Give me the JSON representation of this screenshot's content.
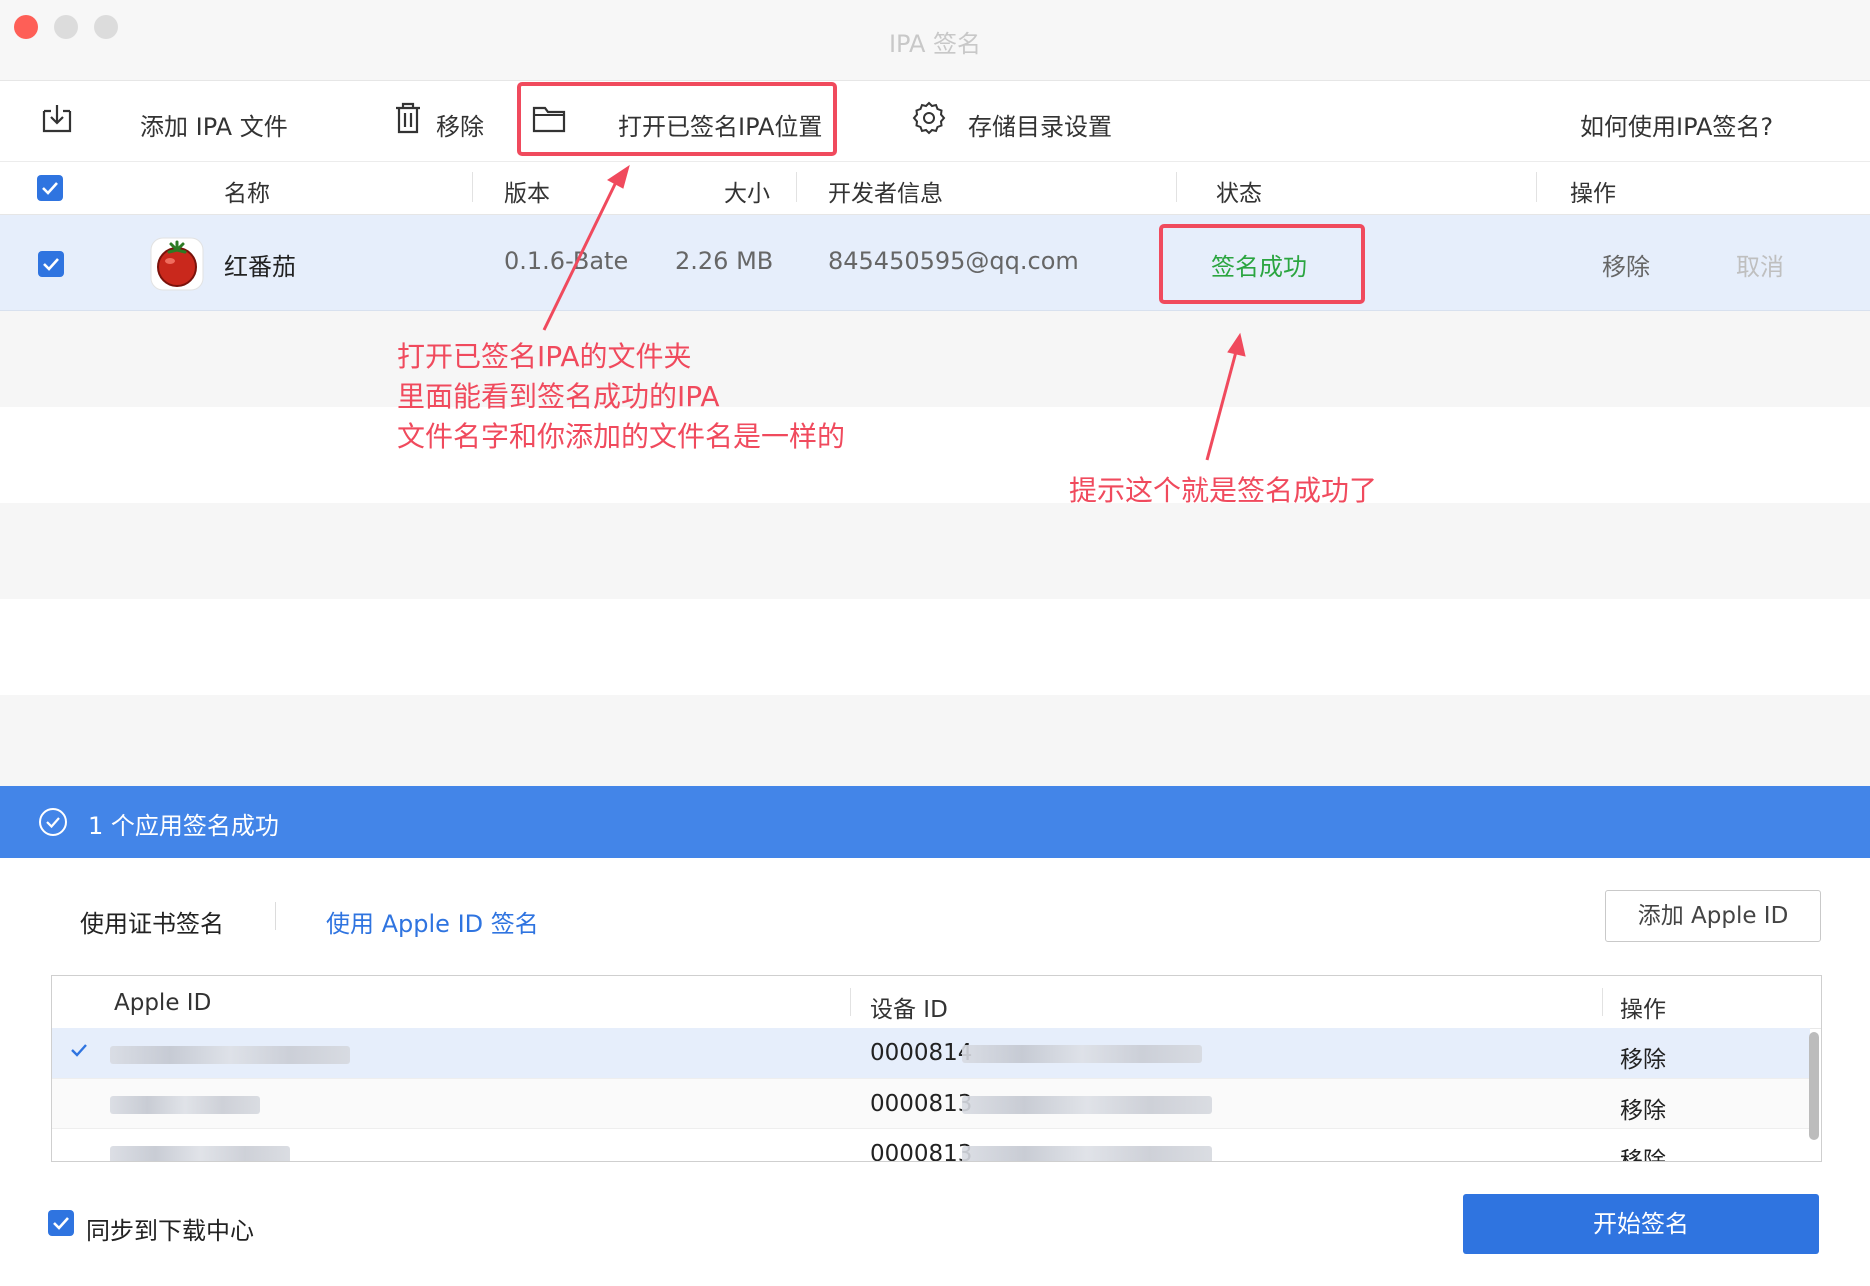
{
  "window": {
    "title": "IPA 签名",
    "traffic_lights": [
      "#fe5f57",
      "#dcdcdc",
      "#dcdcdc"
    ]
  },
  "toolbar": {
    "add_ipa": "添加 IPA 文件",
    "remove": "移除",
    "open_signed_location": "打开已签名IPA位置",
    "storage_settings": "存储目录设置",
    "help": "如何使用IPA签名?"
  },
  "table_header": {
    "name": "名称",
    "version": "版本",
    "size": "大小",
    "developer": "开发者信息",
    "status": "状态",
    "actions": "操作"
  },
  "apps": [
    {
      "name": "红番茄",
      "version": "0.1.6-Bate",
      "size": "2.26 MB",
      "developer": "845450595@qq.com",
      "status": "签名成功",
      "action_remove": "移除",
      "action_cancel": "取消",
      "checked": true
    }
  ],
  "banner": {
    "text": "1 个应用签名成功"
  },
  "sign_tabs": {
    "certificate": "使用证书签名",
    "apple_id": "使用 Apple ID 签名",
    "add_apple_id_button": "添加 Apple ID"
  },
  "apple_id_table": {
    "headers": {
      "apple_id": "Apple ID",
      "device_id": "设备 ID",
      "actions": "操作"
    },
    "rows": [
      {
        "device_id_prefix": "0000814",
        "action": "移除",
        "selected": true
      },
      {
        "device_id_prefix": "0000813",
        "action": "移除",
        "selected": false
      },
      {
        "device_id_prefix": "0000813",
        "action": "移除",
        "selected": false
      }
    ]
  },
  "footer": {
    "sync_label": "同步到下载中心",
    "start_button": "开始签名"
  },
  "annotations": {
    "open_folder_note": [
      "打开已签名IPA的文件夹",
      "里面能看到签名成功的IPA",
      "文件名字和你添加的文件名是一样的"
    ],
    "success_note": "提示这个就是签名成功了"
  },
  "colors": {
    "accent": "#2f74e0",
    "banner": "#4385e8",
    "success_text": "#2ba540",
    "annotation": "#f04a5d",
    "selected_row": "#e6eefb",
    "stripe": "#f6f6f6"
  }
}
